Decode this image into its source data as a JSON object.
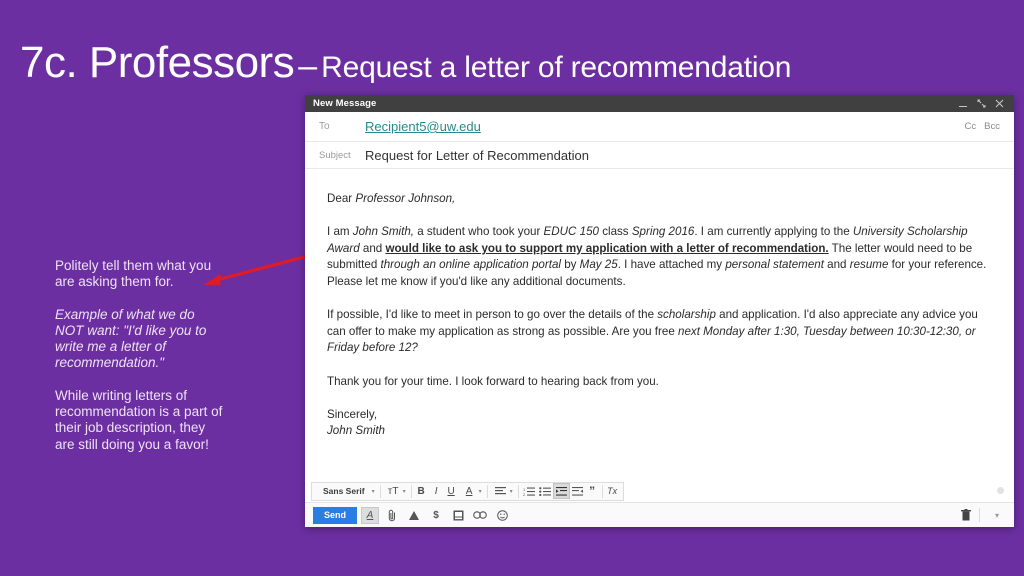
{
  "slide": {
    "title_main": "7c. Professors",
    "title_dash": "–",
    "title_sub": "Request a letter of recommendation",
    "background_color": "#6C2FA2",
    "arrow_color": "#E01B24"
  },
  "annotations": [
    {
      "text": "Politely tell them what you are asking them for.",
      "italic": false
    },
    {
      "text": "Example of what we do NOT want: \"I'd like you to write me a letter of recommendation.\"",
      "italic": true
    },
    {
      "text": "While writing letters of recommendation is a part of their job description, they are still doing you a favor!",
      "italic": false
    }
  ],
  "compose": {
    "window_title": "New Message",
    "window_controls": [
      "minimize",
      "maximize",
      "close"
    ],
    "to_label": "To",
    "to_value": "Recipient5@uw.edu",
    "cc_label": "Cc",
    "bcc_label": "Bcc",
    "subject_label": "Subject",
    "subject_value": "Request for Letter of Recommendation",
    "body": {
      "salutation_prefix": "Dear ",
      "salutation_name": "Professor Johnson,",
      "p1_a": "I am ",
      "p1_name": "John Smith,",
      "p1_b": " a student who took your ",
      "p1_course": "EDUC 150",
      "p1_c": " class ",
      "p1_term": "Spring 2016",
      "p1_d": ". I am currently applying to the ",
      "p1_award": "University Scholarship Award",
      "p1_e": " and ",
      "p1_ask": "would like to ask you to support my application with a letter of recommendation.",
      "p1_f": " The letter would need to be submitted ",
      "p1_portal": "through an online application portal",
      "p1_g": " by ",
      "p1_date": "May 25",
      "p1_h": ". I have attached my ",
      "p1_doc1": "personal statement",
      "p1_i": " and ",
      "p1_doc2": "resume",
      "p1_j": " for your reference. Please let me know if you'd like any additional documents.",
      "p2_a": "If possible, I'd like to meet in person to go over the details of the ",
      "p2_scholarship": "scholarship",
      "p2_b": " and application. I'd also appreciate any advice you can offer to make my application as strong as possible. Are you free ",
      "p2_times": "next Monday after 1:30, Tuesday between 10:30-12:30, or Friday before 12?",
      "p3": "Thank you for your time. I look forward to hearing back from you.",
      "closing": "Sincerely,",
      "signature": "John Smith"
    },
    "format_toolbar": {
      "font_name": "Sans Serif",
      "buttons": [
        {
          "name": "font-size",
          "glyph": "ᴛT"
        },
        {
          "name": "bold",
          "glyph": "B"
        },
        {
          "name": "italic",
          "glyph": "I"
        },
        {
          "name": "underline",
          "glyph": "U"
        },
        {
          "name": "text-color",
          "glyph": "A"
        },
        {
          "name": "align",
          "glyph": "≡"
        },
        {
          "name": "numbered-list",
          "glyph": "≣"
        },
        {
          "name": "bulleted-list",
          "glyph": "≣"
        },
        {
          "name": "indent-less",
          "glyph": "⇥",
          "selected": true
        },
        {
          "name": "indent-more",
          "glyph": "⇤"
        },
        {
          "name": "quote",
          "glyph": "”"
        },
        {
          "name": "remove-formatting",
          "glyph": "Tx"
        }
      ]
    },
    "send_bar": {
      "send_label": "Send",
      "icons": [
        {
          "name": "formatting-options",
          "glyph": "A",
          "selected": true
        },
        {
          "name": "attach-file",
          "glyph": "📎"
        },
        {
          "name": "insert-drive",
          "glyph": "▲"
        },
        {
          "name": "insert-money",
          "glyph": "$"
        },
        {
          "name": "insert-photo",
          "glyph": "❐"
        },
        {
          "name": "insert-link",
          "glyph": "∞"
        },
        {
          "name": "insert-emoji",
          "glyph": "☺"
        }
      ],
      "trash_icon": "🗑",
      "more_options": "▾"
    }
  }
}
